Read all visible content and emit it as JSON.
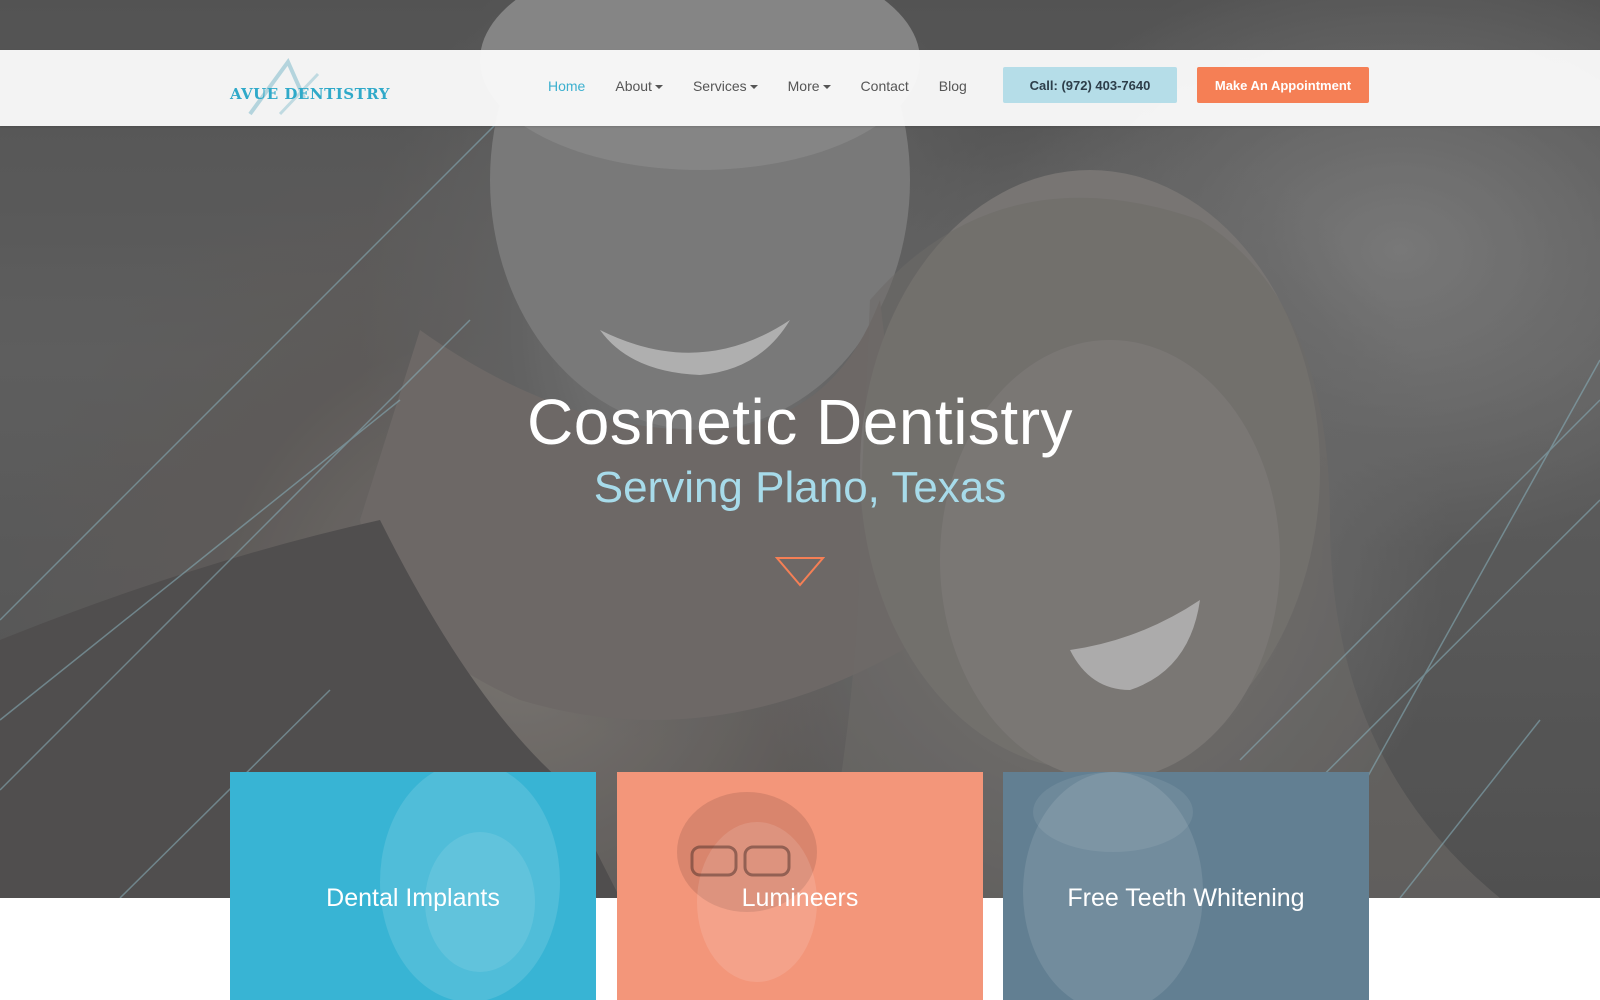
{
  "header": {
    "logo_text": "AVUE DENTISTRY",
    "nav": [
      {
        "label": "Home",
        "active": true,
        "dropdown": false
      },
      {
        "label": "About",
        "active": false,
        "dropdown": true
      },
      {
        "label": "Services",
        "active": false,
        "dropdown": true
      },
      {
        "label": "More",
        "active": false,
        "dropdown": true
      },
      {
        "label": "Contact",
        "active": false,
        "dropdown": false
      },
      {
        "label": "Blog",
        "active": false,
        "dropdown": false
      }
    ],
    "call_button": "Call: (972) 403-7640",
    "appointment_button": "Make An Appointment"
  },
  "hero": {
    "title": "Cosmetic Dentistry",
    "subtitle": "Serving Plano, Texas",
    "scroll_icon": "triangle-down-icon"
  },
  "cards": [
    {
      "label": "Dental Implants",
      "color": "#38b4d4"
    },
    {
      "label": "Lumineers",
      "color": "#f3967a"
    },
    {
      "label": "Free Teeth Whitening",
      "color": "#627f92"
    }
  ],
  "colors": {
    "accent": "#3cb0cf",
    "call_button_bg": "#b5dde8",
    "appointment_button_bg": "#f57f55",
    "subtitle": "#a7dbea"
  }
}
